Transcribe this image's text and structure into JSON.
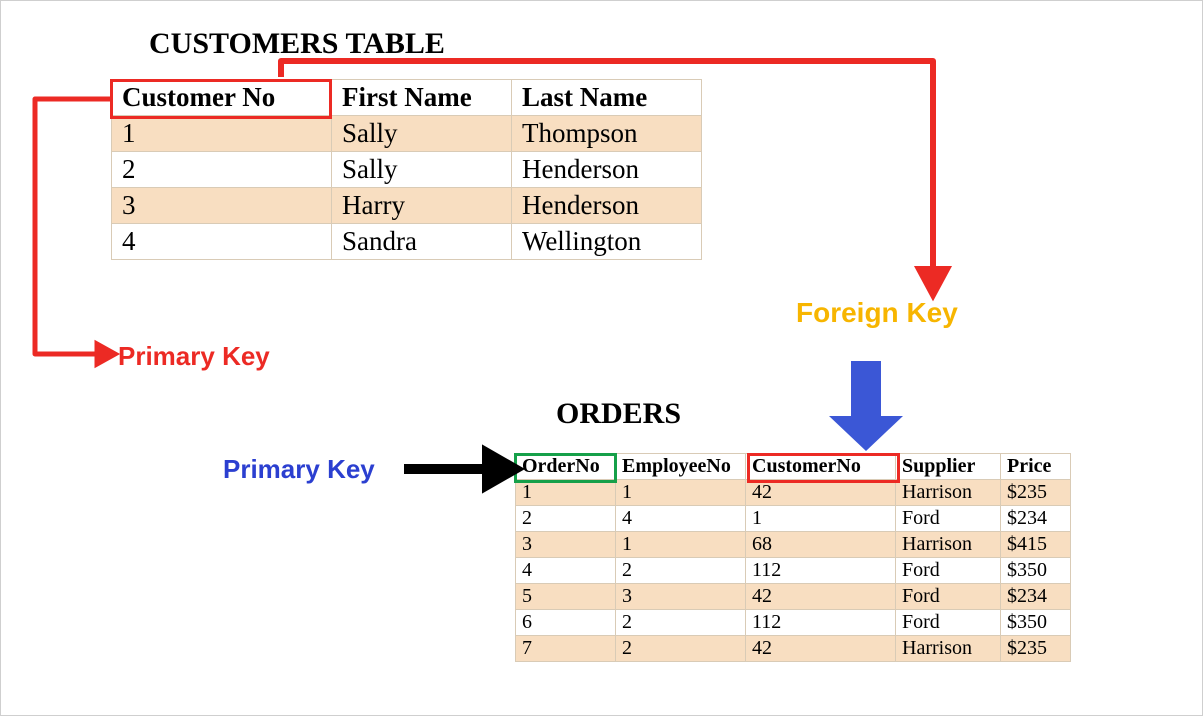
{
  "customers": {
    "title": "CUSTOMERS TABLE",
    "columns": [
      "Customer No",
      "First Name",
      "Last Name"
    ],
    "rows": [
      {
        "no": "1",
        "first": "Sally",
        "last": "Thompson"
      },
      {
        "no": "2",
        "first": "Sally",
        "last": "Henderson"
      },
      {
        "no": "3",
        "first": "Harry",
        "last": "Henderson"
      },
      {
        "no": "4",
        "first": "Sandra",
        "last": "Wellington"
      }
    ]
  },
  "orders": {
    "title": "ORDERS",
    "columns": [
      "OrderNo",
      "EmployeeNo",
      "CustomerNo",
      "Supplier",
      "Price"
    ],
    "rows": [
      {
        "order": "1",
        "emp": "1",
        "cust": "42",
        "supplier": "Harrison",
        "price": "$235"
      },
      {
        "order": "2",
        "emp": "4",
        "cust": "1",
        "supplier": "Ford",
        "price": "$234"
      },
      {
        "order": "3",
        "emp": "1",
        "cust": "68",
        "supplier": "Harrison",
        "price": "$415"
      },
      {
        "order": "4",
        "emp": "2",
        "cust": "112",
        "supplier": "Ford",
        "price": "$350"
      },
      {
        "order": "5",
        "emp": "3",
        "cust": "42",
        "supplier": "Ford",
        "price": "$234"
      },
      {
        "order": "6",
        "emp": "2",
        "cust": "112",
        "supplier": "Ford",
        "price": "$350"
      },
      {
        "order": "7",
        "emp": "2",
        "cust": "42",
        "supplier": "Harrison",
        "price": "$235"
      }
    ]
  },
  "labels": {
    "primary_key_customers": "Primary Key",
    "foreign_key": "Foreign Key",
    "primary_key_orders": "Primary Key"
  },
  "colors": {
    "highlight_red": "#ec2a24",
    "highlight_green": "#16a049",
    "label_yellow": "#f7b500",
    "label_blue": "#2b3fd0",
    "arrow_blue": "#3b57d6"
  },
  "relationships": {
    "primary_key_customers": "Customer No",
    "primary_key_orders": "OrderNo",
    "foreign_key_orders": {
      "column": "CustomerNo",
      "references": "CUSTOMERS.Customer No"
    }
  }
}
